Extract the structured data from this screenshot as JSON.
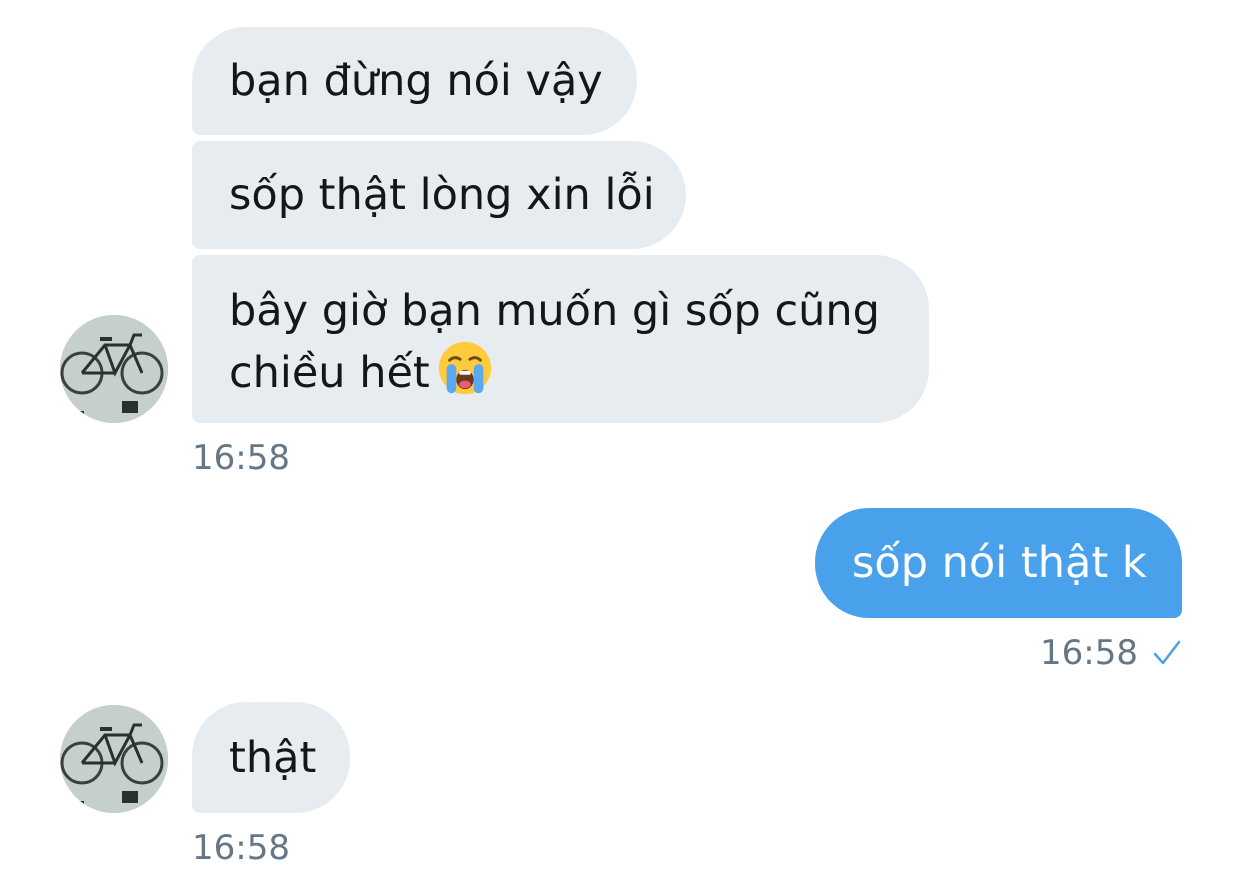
{
  "messages": [
    {
      "direction": "incoming",
      "text": "bạn đừng nói vậy"
    },
    {
      "direction": "incoming",
      "text": "sốp thật lòng xin lỗi"
    },
    {
      "direction": "incoming",
      "text": "bây giờ bạn muốn gì sốp cũng chiều hết",
      "emoji": "loudly-crying-face"
    },
    {
      "direction": "outgoing",
      "text": "sốp nói thật k"
    },
    {
      "direction": "incoming",
      "text": "thật"
    }
  ],
  "timestamps": {
    "group1": "16:58",
    "outgoing": "16:58",
    "group2": "16:58"
  },
  "read_status_icon": "checkmark-icon",
  "avatar_image": "bicycle-on-wall",
  "colors": {
    "incoming_bubble": "#e6ecf0",
    "outgoing_bubble": "#4aa1eb",
    "timestamp_text": "#657786",
    "checkmark": "#4aa1eb"
  }
}
